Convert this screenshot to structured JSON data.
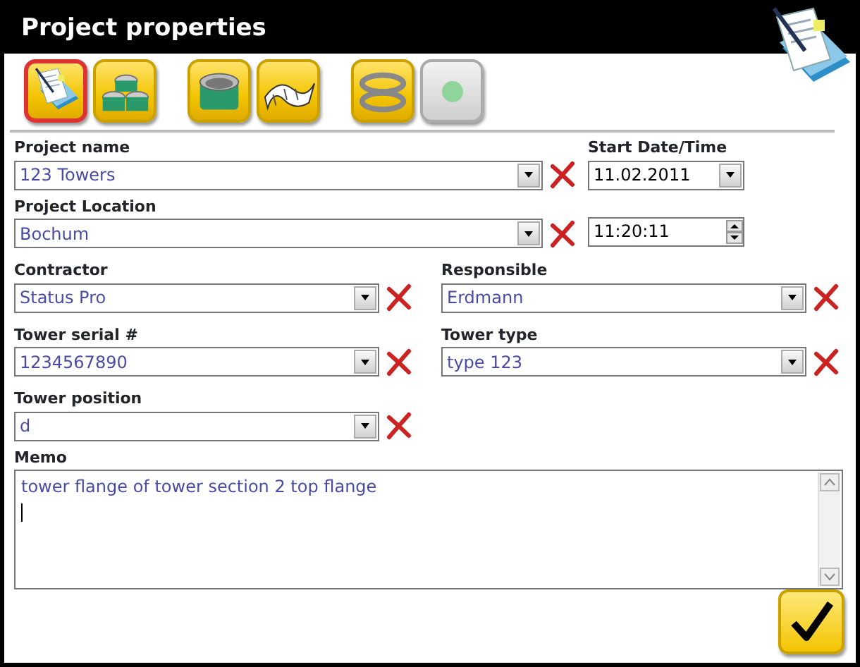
{
  "window": {
    "title": "Project properties"
  },
  "toolbar": [
    [
      {
        "kind": "document",
        "selected": true,
        "disabled": false
      },
      {
        "kind": "sections",
        "selected": false,
        "disabled": false
      }
    ],
    [
      {
        "kind": "section",
        "selected": false,
        "disabled": false
      },
      {
        "kind": "sheet",
        "selected": false,
        "disabled": false
      }
    ],
    [
      {
        "kind": "flanges",
        "selected": false,
        "disabled": false
      },
      {
        "kind": "lamp",
        "selected": false,
        "disabled": true
      }
    ]
  ],
  "project_name": {
    "label": "Project name",
    "value": "123 Towers"
  },
  "start": {
    "label": "Start Date/Time",
    "date": "11.02.2011",
    "time": "11:20:11"
  },
  "project_location": {
    "label": "Project Location",
    "value": "Bochum"
  },
  "contractor": {
    "label": "Contractor",
    "value": "Status Pro"
  },
  "responsible": {
    "label": "Responsible",
    "value": "Erdmann"
  },
  "tower_serial": {
    "label": "Tower serial #",
    "value": "1234567890"
  },
  "tower_type": {
    "label": "Tower type",
    "value": "type 123"
  },
  "tower_position": {
    "label": "Tower position",
    "value": "d"
  },
  "memo": {
    "label": "Memo",
    "value": "tower flange of tower section 2 top flange"
  }
}
